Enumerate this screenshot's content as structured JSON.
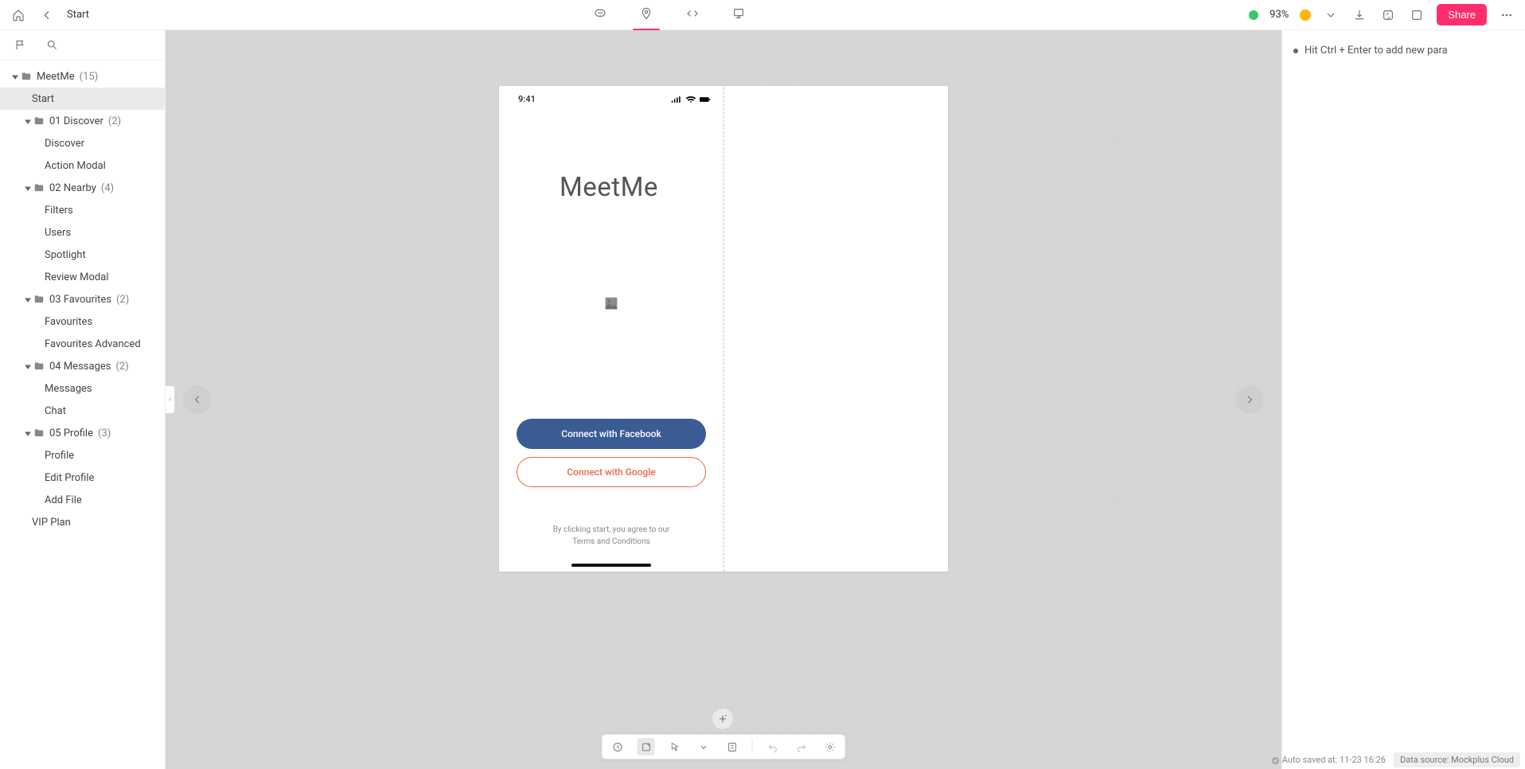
{
  "header": {
    "breadcrumb": "Start",
    "zoom_percent": "93%",
    "share_label": "Share"
  },
  "sidebar": {
    "tree": [
      {
        "label": "MeetMe",
        "count": "(15)",
        "level": 1,
        "folder": true,
        "expanded": true
      },
      {
        "label": "Start",
        "level": "leaf1",
        "selected": true
      },
      {
        "label": "01 Discover",
        "count": "(2)",
        "level": 2,
        "folder": true,
        "expanded": true
      },
      {
        "label": "Discover",
        "level": 3
      },
      {
        "label": "Action Modal",
        "level": 3
      },
      {
        "label": "02 Nearby",
        "count": "(4)",
        "level": 2,
        "folder": true,
        "expanded": true
      },
      {
        "label": "Filters",
        "level": 3
      },
      {
        "label": "Users",
        "level": 3
      },
      {
        "label": "Spotlight",
        "level": 3
      },
      {
        "label": "Review Modal",
        "level": 3
      },
      {
        "label": "03 Favourites",
        "count": "(2)",
        "level": 2,
        "folder": true,
        "expanded": true
      },
      {
        "label": "Favourites",
        "level": 3
      },
      {
        "label": "Favourites Advanced",
        "level": 3
      },
      {
        "label": "04 Messages",
        "count": "(2)",
        "level": 2,
        "folder": true,
        "expanded": true
      },
      {
        "label": "Messages",
        "level": 3
      },
      {
        "label": "Chat",
        "level": 3
      },
      {
        "label": "05 Profile",
        "count": "(3)",
        "level": 2,
        "folder": true,
        "expanded": true
      },
      {
        "label": "Profile",
        "level": 3
      },
      {
        "label": "Edit Profile",
        "level": 3
      },
      {
        "label": "Add File",
        "level": 3
      },
      {
        "label": "VIP Plan",
        "level": "leaf1"
      }
    ]
  },
  "mock": {
    "status_time": "9:41",
    "app_title": "MeetMe",
    "btn_facebook": "Connect with Facebook",
    "btn_google": "Connect with Google",
    "terms_line1": "By clicking start, you agree to our",
    "terms_line2": "Terms and Conditions"
  },
  "right_panel": {
    "hint": "Hit Ctrl + Enter to add new para"
  },
  "status": {
    "autosave": "Auto saved at: 11-23 16:26",
    "datasource": "Data source: Mockplus Cloud"
  }
}
